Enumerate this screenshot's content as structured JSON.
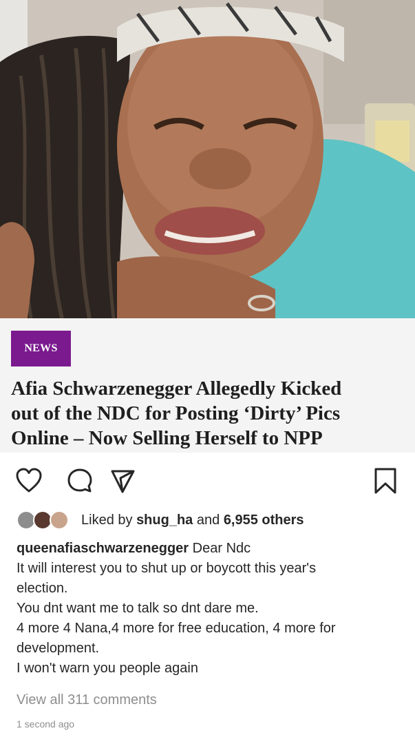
{
  "photo": {
    "description_icon": "photo-image"
  },
  "article": {
    "badge": "NEWS",
    "headline_lines": [
      "Afia Schwarzenegger Allegedly Kicked",
      "out of the NDC for Posting ‘Dirty’ Pics",
      "Online – Now Selling Herself to NPP"
    ],
    "badge_color": "#7a1a8e"
  },
  "actions": {
    "like_icon": "heart-icon",
    "comment_icon": "comment-icon",
    "share_icon": "send-icon",
    "save_icon": "bookmark-icon"
  },
  "likes": {
    "prefix": "Liked by",
    "user": "shug_ha",
    "joiner": "and",
    "others": "6,955 others"
  },
  "caption": {
    "username": "queenafiaschwarzenegger",
    "first_line": "Dear Ndc",
    "lines": [
      "It will interest you to shut up or boycott this year's",
      "election.",
      "You dnt want me to talk so dnt dare me.",
      "4 more 4 Nana,4 more for free education, 4 more for",
      "development.",
      "I won't warn you people again"
    ]
  },
  "comments": {
    "view_all": "View all 311 comments"
  },
  "timestamp": "1 second ago",
  "colors": {
    "text": "#262626",
    "muted": "#8e8e8e",
    "card_bg": "#f4f4f4"
  }
}
